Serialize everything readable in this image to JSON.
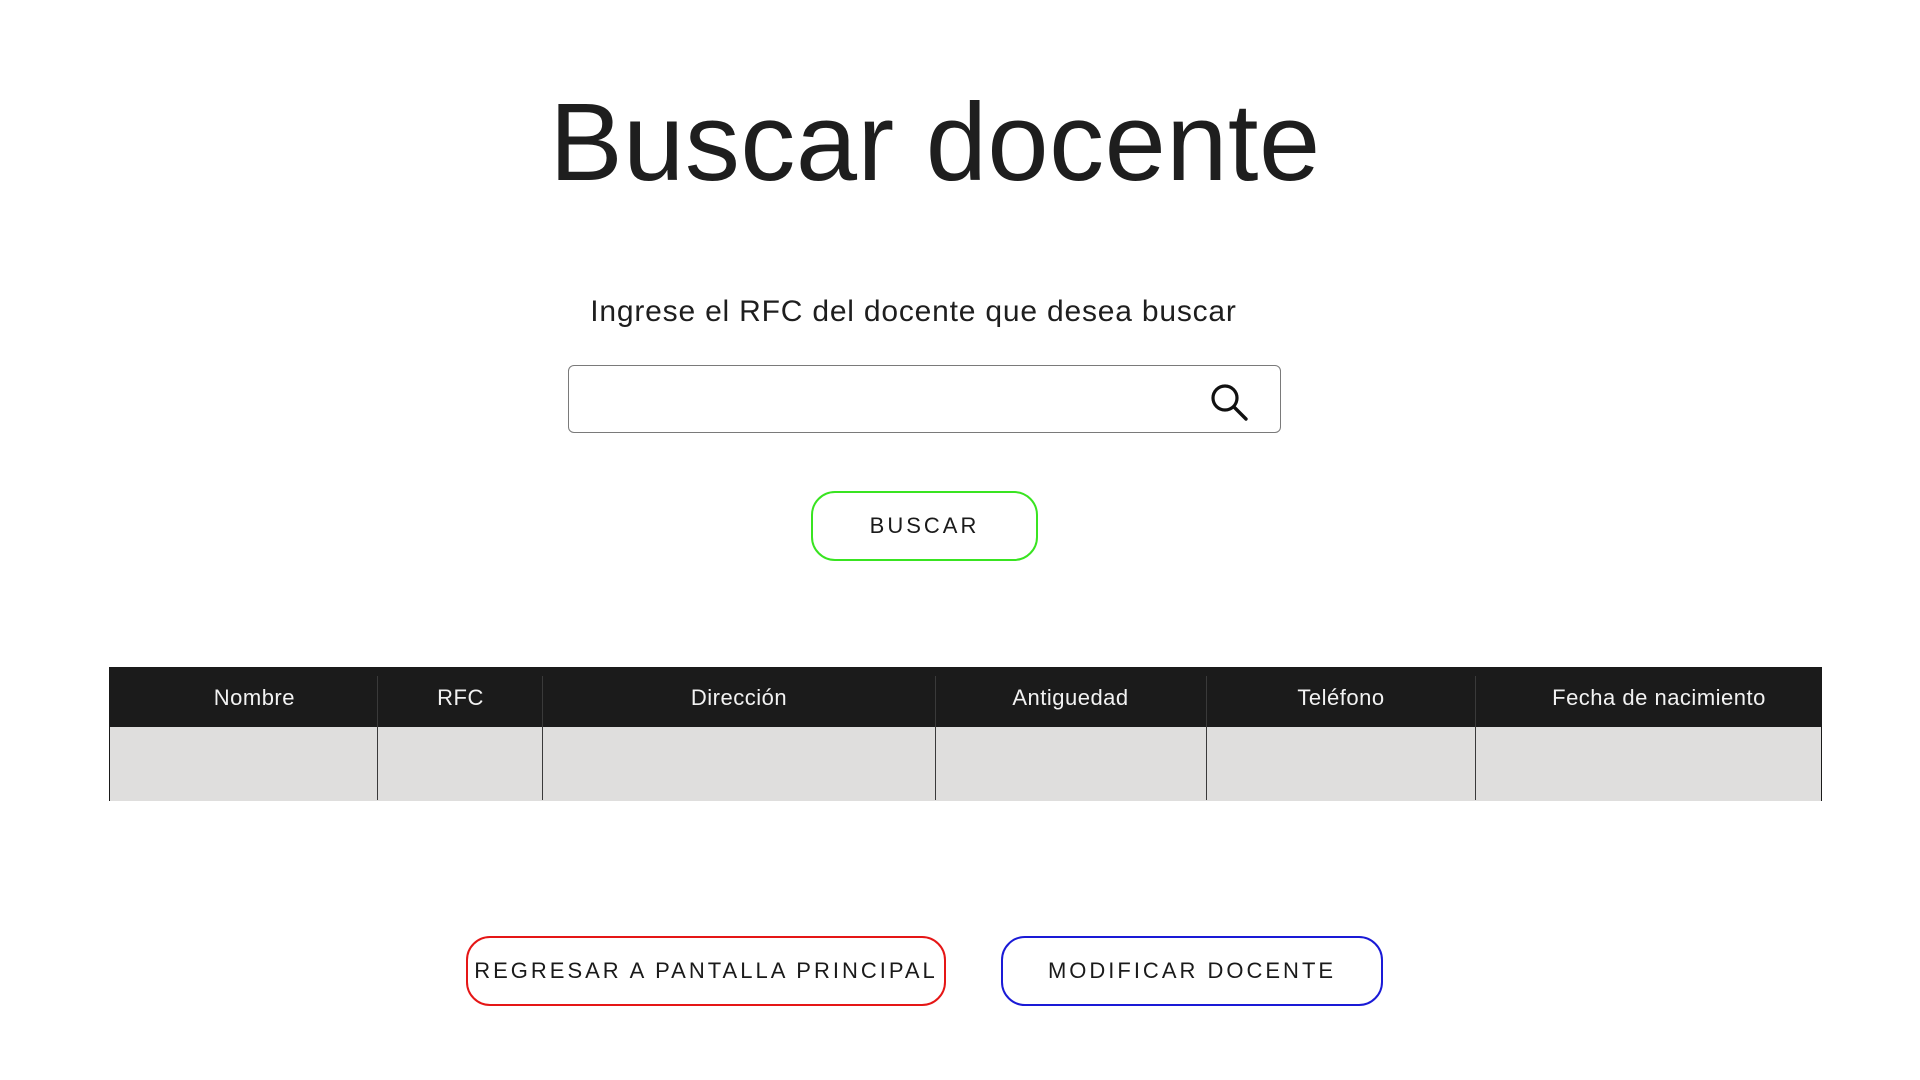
{
  "page": {
    "title": "Buscar docente",
    "instruction": "Ingrese el RFC del docente que desea buscar"
  },
  "search": {
    "value": "",
    "placeholder": ""
  },
  "buttons": {
    "buscar": "BUSCAR",
    "regresar": "REGRESAR A PANTALLA PRINCIPAL",
    "modificar": "MODIFICAR DOCENTE"
  },
  "table": {
    "columns": [
      "Nombre",
      "RFC",
      "Dirección",
      "Antiguedad",
      "Teléfono",
      "Fecha de nacimiento"
    ],
    "rows": [
      [
        "",
        "",
        "",
        "",
        "",
        ""
      ]
    ]
  },
  "colors": {
    "buscar_border": "#39e421",
    "regresar_border": "#e51616",
    "modificar_border": "#1a1ad6",
    "table_header_bg": "#1b1b1b",
    "table_body_bg": "#dfdedd"
  },
  "icons": {
    "search": "search-icon"
  }
}
